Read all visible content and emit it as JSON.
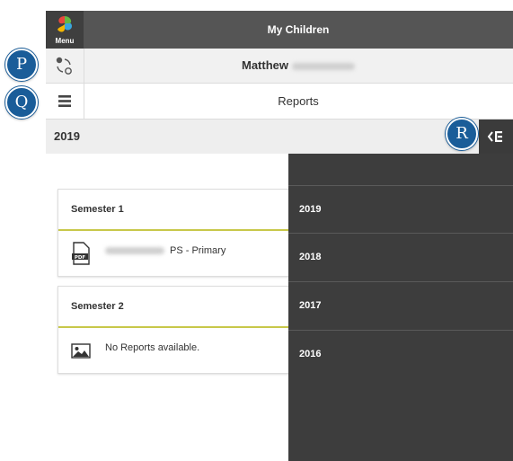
{
  "header": {
    "menu_label": "Menu",
    "title": "My Children"
  },
  "child": {
    "name": "Matthew",
    "icon": "switch-child-icon"
  },
  "section": {
    "label": "Reports",
    "icon": "hamburger-icon"
  },
  "year_bar": {
    "selected_year": "2019",
    "toggle_icon": "panel-toggle-icon"
  },
  "semesters": [
    {
      "title": "Semester 1",
      "icon": "pdf-icon",
      "text": "PS - Primary"
    },
    {
      "title": "Semester 2",
      "icon": "image-icon",
      "text": "No Reports available."
    }
  ],
  "year_options": [
    "2019",
    "2018",
    "2017",
    "2016"
  ],
  "callouts": [
    "P",
    "Q",
    "R"
  ],
  "colors": {
    "topbar": "#555555",
    "panel": "#3d3d3d",
    "accent_line": "#c8c84a",
    "callout": "#1a5d99"
  }
}
